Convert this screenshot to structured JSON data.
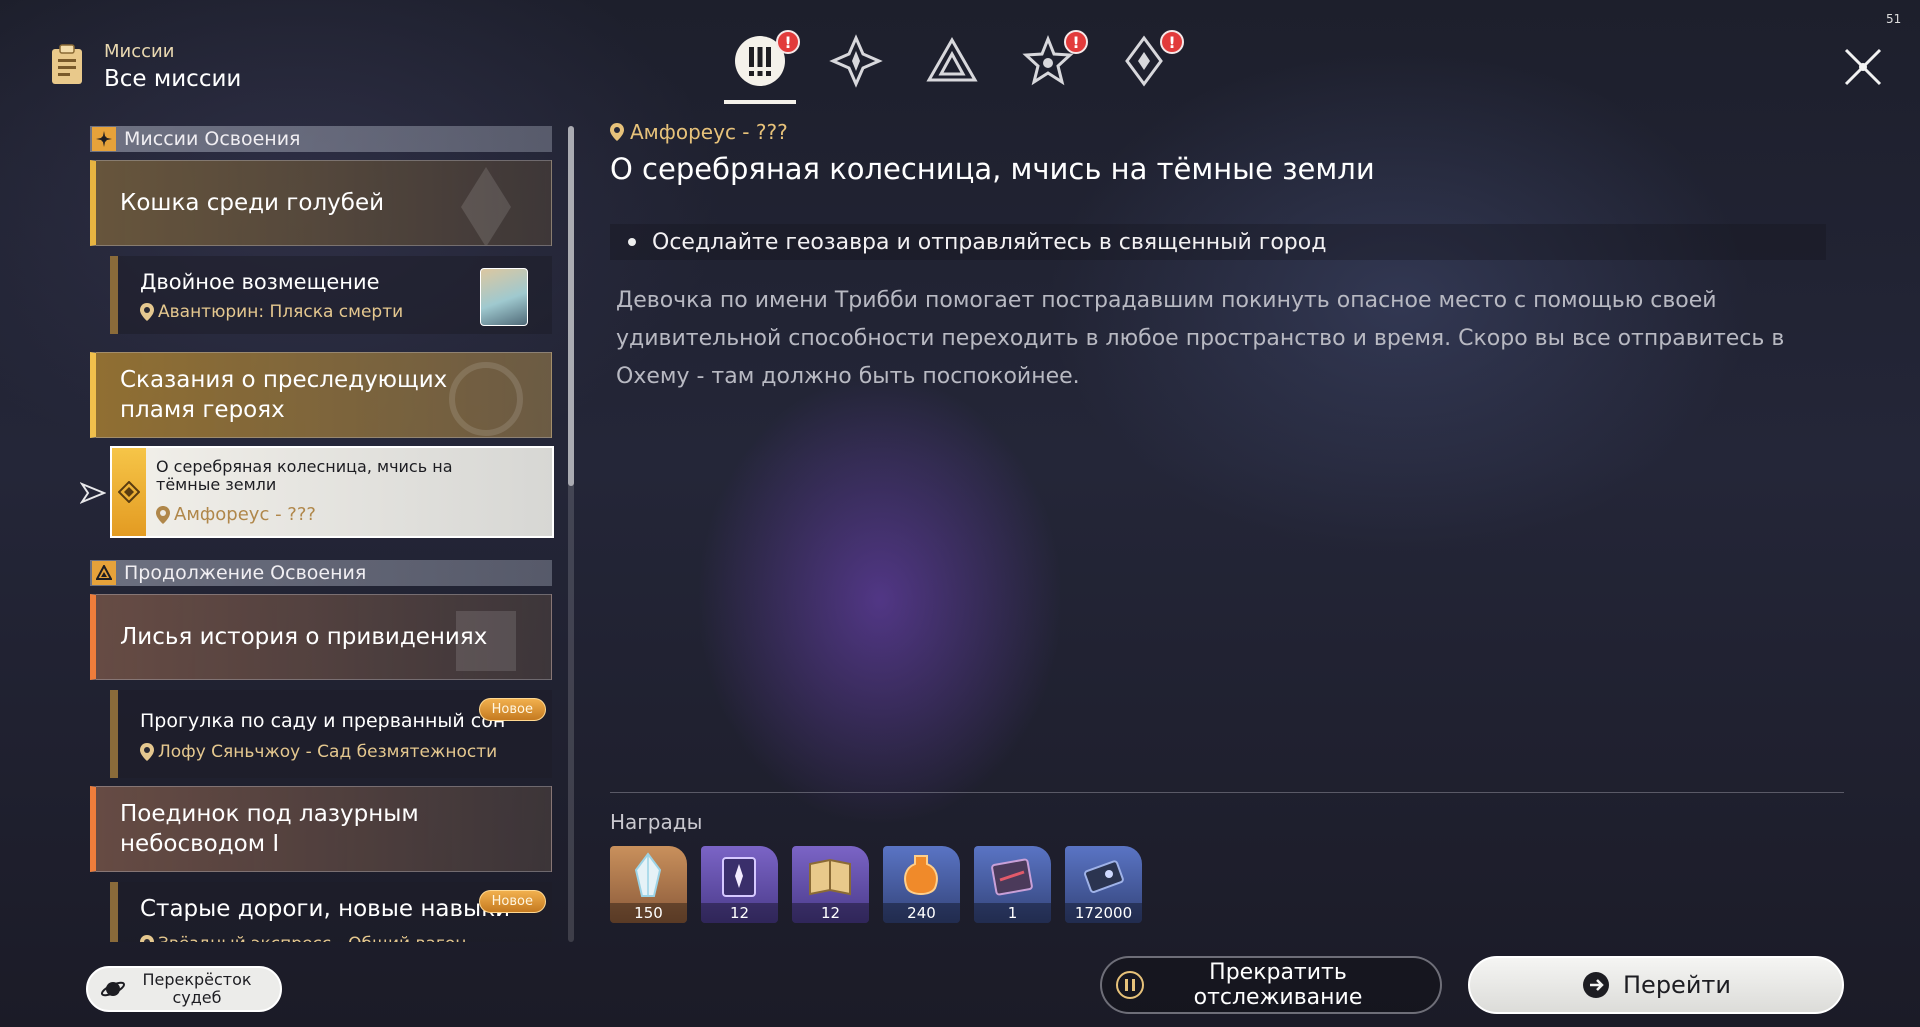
{
  "header": {
    "subtitle": "Миссии",
    "title": "Все миссии"
  },
  "fps": "51",
  "tabs": [
    {
      "icon": "trailblaze-missions-icon",
      "active": true,
      "badge": "!"
    },
    {
      "icon": "companion-missions-icon",
      "active": false,
      "badge": ""
    },
    {
      "icon": "adventure-missions-icon",
      "active": false,
      "badge": ""
    },
    {
      "icon": "event-missions-icon",
      "active": false,
      "badge": "!"
    },
    {
      "icon": "daily-missions-icon",
      "active": false,
      "badge": "!"
    }
  ],
  "list": {
    "sections": [
      {
        "label": "Миссии Освоения"
      },
      {
        "label": "Продолжение Освоения"
      }
    ],
    "missions": [
      {
        "title": "Кошка среди голубей"
      },
      {
        "title": "Сказания о преследующих пламя героях"
      },
      {
        "title": "Лисья история о привидениях"
      },
      {
        "title": "Поединок под лазурным небосводом I"
      }
    ],
    "subs": [
      {
        "title": "Двойное возмещение",
        "location": "Авантюрин: Пляска смерти"
      },
      {
        "title": "О серебряная колесница, мчись на тёмные земли",
        "location": "Амфореус - ???"
      },
      {
        "title": "Прогулка по саду и прерванный сон",
        "location": "Лофу Сяньчжоу - Сад безмятежности",
        "badge": "Новое"
      },
      {
        "title": "Старые дороги, новые навыки",
        "location": "Звёздный экспресс - Общий вагон",
        "badge": "Новое"
      }
    ]
  },
  "detail": {
    "location": "Амфореус - ???",
    "title": "О серебряная колесница, мчись на тёмные земли",
    "objective": "Оседлайте геозавра и отправляйтесь в священный город",
    "description": "Девочка по имени Трибби помогает пострадавшим покинуть опасное место с помощью своей удивительной способности переходить в любое пространство и время. Скоро вы все отправитесь в Охему - там должно быть поспокойнее.",
    "rewards_label": "Награды",
    "rewards": [
      {
        "icon": "stellar-jade-icon",
        "count": "150"
      },
      {
        "icon": "character-exp-material-icon",
        "count": "12"
      },
      {
        "icon": "traveler-guide-icon",
        "count": "12"
      },
      {
        "icon": "fuel-icon",
        "count": "240"
      },
      {
        "icon": "light-cone-exp-icon",
        "count": "1"
      },
      {
        "icon": "credit-icon",
        "count": "172000"
      }
    ]
  },
  "buttons": {
    "crossroads": "Перекрёсток судеб",
    "stop_tracking": "Прекратить отслеживание",
    "go": "Перейти"
  }
}
